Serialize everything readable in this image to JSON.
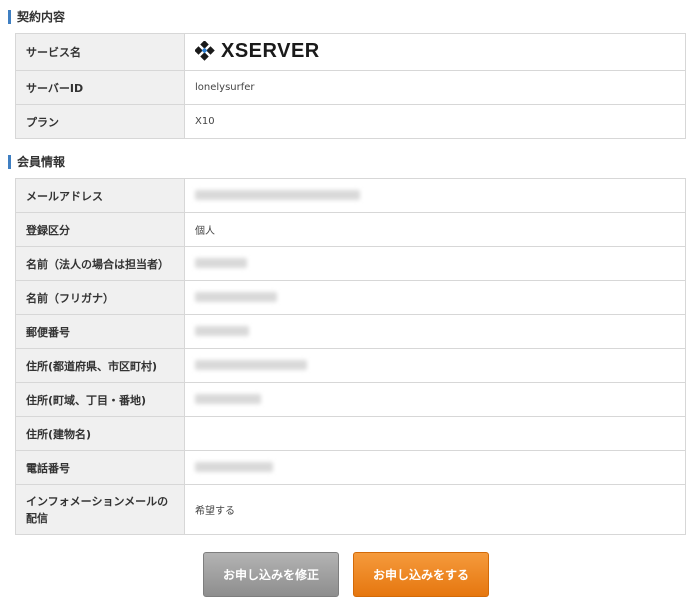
{
  "contract": {
    "heading": "契約内容",
    "rows": [
      {
        "label": "サービス名",
        "logo_text": "XSERVER"
      },
      {
        "label": "サーバーID",
        "value": "lonelysurfer"
      },
      {
        "label": "プラン",
        "value": "X10"
      }
    ]
  },
  "member": {
    "heading": "会員情報",
    "rows": [
      {
        "label": "メールアドレス"
      },
      {
        "label": "登録区分",
        "value": "個人"
      },
      {
        "label": "名前（法人の場合は担当者）"
      },
      {
        "label": "名前（フリガナ）"
      },
      {
        "label": "郵便番号"
      },
      {
        "label": "住所(都道府県、市区町村)"
      },
      {
        "label": "住所(町域、丁目・番地)"
      },
      {
        "label": "住所(建物名)"
      },
      {
        "label": "電話番号"
      },
      {
        "label": "インフォメーションメールの配信",
        "value": "希望する"
      }
    ]
  },
  "buttons": {
    "edit": "お申し込みを修正",
    "submit": "お申し込みをする"
  },
  "colors": {
    "accent_bar": "#3f7fc2",
    "label_bg": "#f0f0f0",
    "submit_button": "#ef8a22",
    "edit_button": "#a3a3a3"
  }
}
